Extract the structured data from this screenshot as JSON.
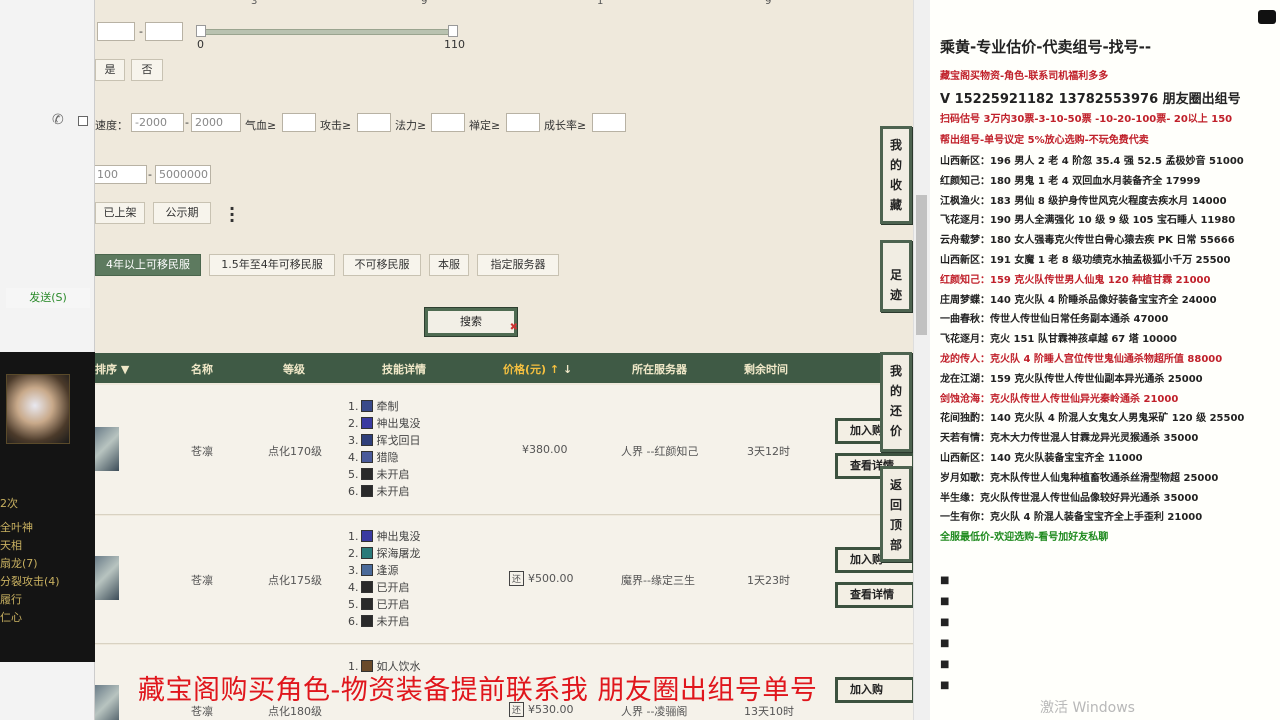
{
  "left": {
    "send_label": "发送(S)",
    "panel_lines": [
      "2次",
      "全叶神",
      "天相",
      "扇龙(7)",
      "分裂攻击(4)",
      "履行",
      "仁心"
    ]
  },
  "slider": {
    "min_label": "0",
    "max_label": "110",
    "top_ticks": [
      "3",
      "9",
      "1",
      "9"
    ]
  },
  "filters": {
    "yes": "是",
    "no": "否",
    "speed_label": "速度：",
    "speed_from": "-2000",
    "speed_to": "2000",
    "hp_label": "气血≥",
    "atk_label": "攻击≥",
    "magic_label": "法力≥",
    "zen_label": "禅定≥",
    "growth_label": "成长率≥",
    "price_from": "100",
    "price_to": "5000000",
    "listed": "已上架",
    "public": "公示期",
    "migrate_tabs": [
      "4年以上可移民服",
      "1.5年至4年可移民服",
      "不可移民服",
      "本服",
      "指定服务器"
    ],
    "search": "搜索"
  },
  "table": {
    "headers": {
      "sort": "排序",
      "name": "名称",
      "level": "等级",
      "skills": "技能详情",
      "price": "价格(元)",
      "server": "所在服务器",
      "remaining": "剩余时间"
    },
    "rows": [
      {
        "name": "苍凛",
        "level": "点化170级",
        "price": "¥380.00",
        "server": "人界 --红颜知己",
        "remaining": "3天12时",
        "has_huan": false,
        "skills": [
          {
            "n": "1.",
            "s": "牵制",
            "c": "#3a4a8a"
          },
          {
            "n": "2.",
            "s": "神出鬼没",
            "c": "#3a3aa0"
          },
          {
            "n": "3.",
            "s": "挥戈回日",
            "c": "#2f3f7a"
          },
          {
            "n": "4.",
            "s": "猎隐",
            "c": "#4a5a9a"
          },
          {
            "n": "5.",
            "s": "未开启",
            "c": "#2a2a2a"
          },
          {
            "n": "6.",
            "s": "未开启",
            "c": "#2a2a2a"
          }
        ]
      },
      {
        "name": "苍凛",
        "level": "点化175级",
        "price": "¥500.00",
        "server": "魔界--缘定三生",
        "remaining": "1天23时",
        "has_huan": true,
        "skills": [
          {
            "n": "1.",
            "s": "神出鬼没",
            "c": "#3a3aa0"
          },
          {
            "n": "2.",
            "s": "探海屠龙",
            "c": "#2a7a7a"
          },
          {
            "n": "3.",
            "s": "逢源",
            "c": "#4a6a9a"
          },
          {
            "n": "4.",
            "s": "已开启",
            "c": "#2a2a2a"
          },
          {
            "n": "5.",
            "s": "已开启",
            "c": "#2a2a2a"
          },
          {
            "n": "6.",
            "s": "未开启",
            "c": "#2a2a2a"
          }
        ]
      },
      {
        "name": "苍凛",
        "level": "点化180级",
        "price": "¥530.00",
        "server": "人界 --凌骊阁",
        "remaining": "13天10时",
        "has_huan": true,
        "skills": [
          {
            "n": "1.",
            "s": "如人饮水",
            "c": "#6a4a2a"
          }
        ]
      }
    ],
    "add_label": "加入购",
    "detail_label": "查看详情"
  },
  "vnav": [
    {
      "label": "我的收藏"
    },
    {
      "label": "足迹"
    },
    {
      "label": "我的还价"
    },
    {
      "label": "返回顶部"
    }
  ],
  "right_panel": {
    "title": "乘黄-专业估价-代卖组号-找号--",
    "lines": [
      {
        "t": "藏宝阁买物资-角色-联系司机福利多多",
        "cls": "rp-red"
      },
      {
        "t": "V 15225921182   13782553976 朋友圈出组号",
        "cls": "rp-big"
      },
      {
        "t": "扫码估号 3万内30票-3-10-50票 -10-20-100票- 20以上 150",
        "cls": "rp-red"
      },
      {
        "t": "帮出组号-单号议定 5%放心选购-不玩免费代卖",
        "cls": "rp-red"
      },
      {
        "t": "山西新区：196 男人 2 老 4 阶忽 35.4 强 52.5 孟极妙音 51000",
        "cls": ""
      },
      {
        "t": "红颜知己：180 男鬼 1 老 4 双回血水月装备齐全 17999",
        "cls": ""
      },
      {
        "t": "江枫渔火：183 男仙 8 级护身传世风克火程度去疾水月 14000",
        "cls": ""
      },
      {
        "t": "飞花逐月：190 男人全满强化 10 级 9 级 105 宝石睡人 11980",
        "cls": ""
      },
      {
        "t": "云舟载梦：180 女人强毒克火传世白骨心猿去疾 PK 日常 55666",
        "cls": ""
      },
      {
        "t": "山西新区：191 女魔 1 老 8 级功绩克水抽孟极狐小千万 25500",
        "cls": ""
      },
      {
        "t": "红颜知己：159 克火队传世男人仙鬼 120 种植甘霖 21000",
        "cls": "rp-red"
      },
      {
        "t": "庄周梦蝶：140 克火队 4 阶睡杀品像好装备宝宝齐全 24000",
        "cls": ""
      },
      {
        "t": "一曲春秋：传世人传世仙日常任务副本通杀 47000",
        "cls": ""
      },
      {
        "t": "飞花逐月：克火 151 队甘霖神孩卓越 67 塔 10000",
        "cls": ""
      },
      {
        "t": "龙的传人：克火队 4 阶睡人宫位传世鬼仙通杀物超所值 88000",
        "cls": "rp-red"
      },
      {
        "t": "龙在江湖：159 克火队传世人传世仙副本异光通杀 25000",
        "cls": ""
      },
      {
        "t": "剑蚀沧海：克火队传世人传世仙异光秦岭通杀 21000",
        "cls": "rp-red"
      },
      {
        "t": "花间独酌：140 克火队 4 阶混人女鬼女人男鬼采矿 120 级 25500",
        "cls": ""
      },
      {
        "t": "天若有情：克木大力传世混人甘霖龙异光灵猴通杀 35000",
        "cls": ""
      },
      {
        "t": "山西新区：140 克火队装备宝宝齐全 11000",
        "cls": ""
      },
      {
        "t": "岁月如歌：克木队传世人仙鬼种植畜牧通杀丝滑型物超 25000",
        "cls": ""
      },
      {
        "t": "半生缘：克火队传世混人传世仙品像较好异光通杀 35000",
        "cls": ""
      },
      {
        "t": "一生有你：克火队 4 阶混人装备宝宝齐全上手歪利 21000",
        "cls": ""
      },
      {
        "t": "全服最低价-欢迎选购-看号加好友私聊",
        "cls": "rp-green"
      }
    ]
  },
  "overlay": {
    "caption": "藏宝阁购买角色-物资装备提前联系我      朋友圈出组号单号",
    "activate": "激活 Windows"
  }
}
